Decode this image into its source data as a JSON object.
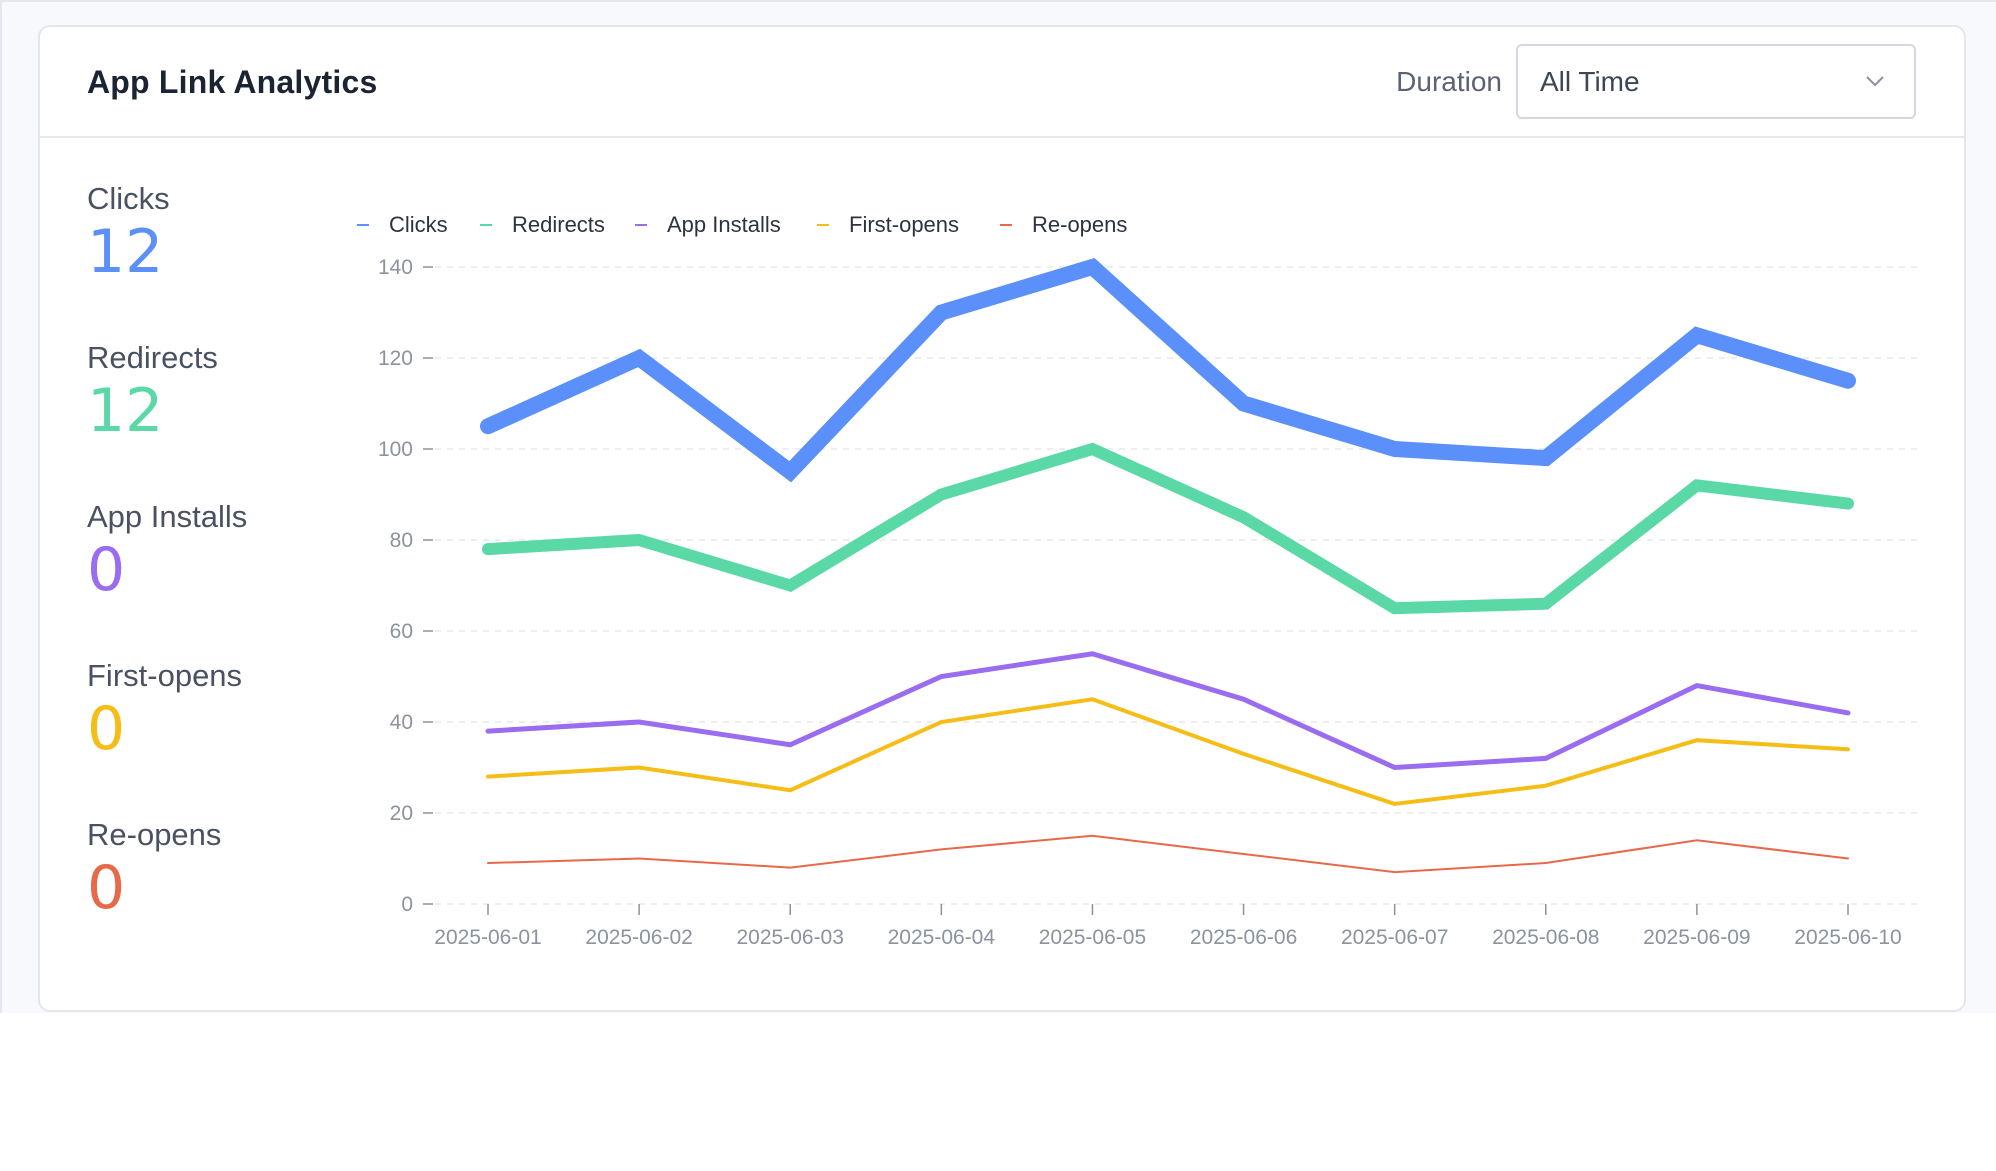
{
  "card": {
    "title": "App Link Analytics",
    "duration_label": "Duration",
    "duration_value": "All Time"
  },
  "stats": [
    {
      "label": "Clicks",
      "value": "12",
      "color": "#5b8ff9"
    },
    {
      "label": "Redirects",
      "value": "12",
      "color": "#5ad8a6"
    },
    {
      "label": "App Installs",
      "value": "0",
      "color": "#9a6cf0"
    },
    {
      "label": "First-opens",
      "value": "0",
      "color": "#f6bd16"
    },
    {
      "label": "Re-opens",
      "value": "0",
      "color": "#e8684a"
    }
  ],
  "icons": {
    "duration_dropdown": "chevron-down-icon"
  },
  "chart_data": {
    "type": "line",
    "x": [
      "2025-06-01",
      "2025-06-02",
      "2025-06-03",
      "2025-06-04",
      "2025-06-05",
      "2025-06-06",
      "2025-06-07",
      "2025-06-08",
      "2025-06-09",
      "2025-06-10"
    ],
    "ylim": [
      0,
      140
    ],
    "yticks": [
      0,
      20,
      40,
      60,
      80,
      100,
      120,
      140
    ],
    "grid": true,
    "legend_position": "top-left",
    "series": [
      {
        "name": "Clicks",
        "color": "#5b8ff9",
        "values": [
          105,
          120,
          95,
          130,
          140,
          110,
          100,
          98,
          125,
          115
        ]
      },
      {
        "name": "Redirects",
        "color": "#5ad8a6",
        "values": [
          78,
          80,
          70,
          90,
          100,
          85,
          65,
          66,
          92,
          88
        ]
      },
      {
        "name": "App Installs",
        "color": "#9a6cf0",
        "values": [
          38,
          40,
          35,
          50,
          55,
          45,
          30,
          32,
          48,
          42
        ]
      },
      {
        "name": "First-opens",
        "color": "#f6bd16",
        "values": [
          28,
          30,
          25,
          40,
          45,
          33,
          22,
          26,
          36,
          34
        ]
      },
      {
        "name": "Re-opens",
        "color": "#e8684a",
        "values": [
          9,
          10,
          8,
          12,
          15,
          11,
          7,
          9,
          14,
          10
        ]
      }
    ]
  }
}
